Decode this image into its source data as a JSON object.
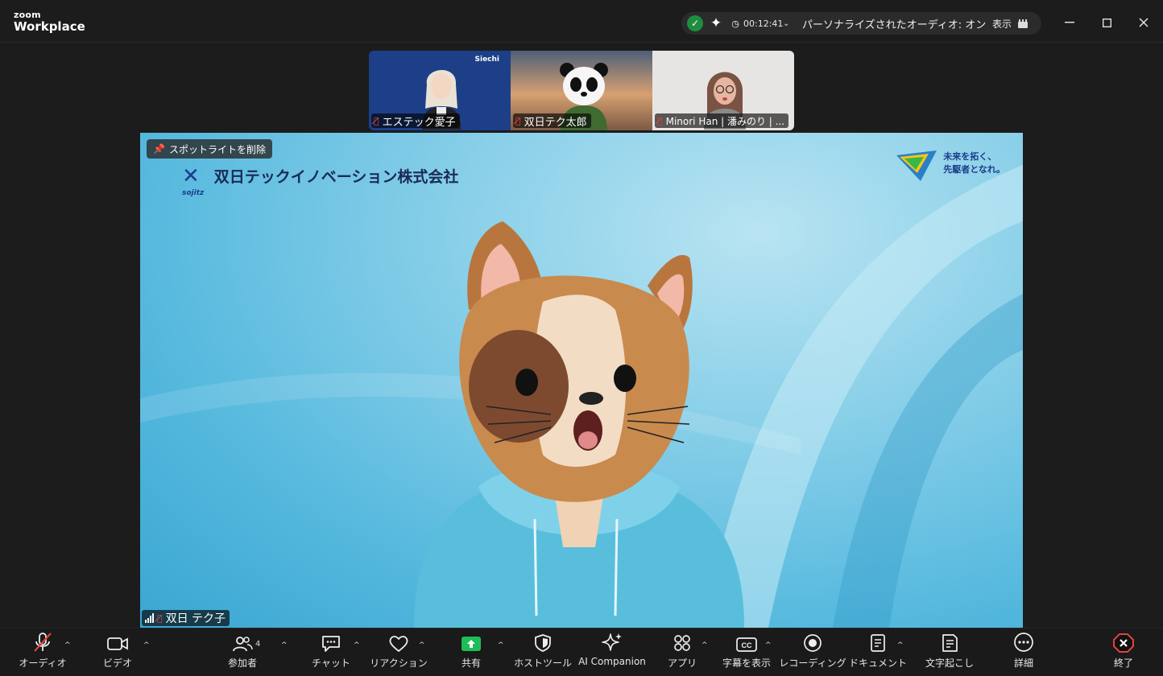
{
  "app": {
    "brand_small": "zoom",
    "brand_big": "Workplace"
  },
  "status": {
    "timer": "00:12:41",
    "audio": "パーソナライズされたオーディオ: オン",
    "view": "表示"
  },
  "participants": [
    {
      "name": "エステック愛子",
      "muted": true,
      "badge_text": "Siechi"
    },
    {
      "name": "双日テク太郎",
      "muted": true
    },
    {
      "name": "Minori Han | 潘みのり | ...",
      "muted": true
    }
  ],
  "speaker": {
    "spotlight_button": "スポットライトを削除",
    "company_name": "双日テックイノベーション株式会社",
    "company_brand": "sojitz",
    "tagline": "未来を拓く、\n先駆者となれ。",
    "name": "双日 テク子"
  },
  "toolbar": {
    "audio": "オーディオ",
    "video": "ビデオ",
    "participants": "参加者",
    "participants_count": "4",
    "chat": "チャット",
    "reaction": "リアクション",
    "share": "共有",
    "host_tools": "ホストツール",
    "ai_companion": "AI Companion",
    "apps": "アプリ",
    "captions": "字幕を表示",
    "recording": "レコーディング",
    "document": "ドキュメント",
    "transcript": "文字起こし",
    "more": "詳細",
    "end": "終了"
  },
  "colors": {
    "share_green": "#1fbd59",
    "end_red": "#e0443e",
    "brand_navy": "#1b3c8c",
    "secure_green": "#1e8e3e"
  }
}
